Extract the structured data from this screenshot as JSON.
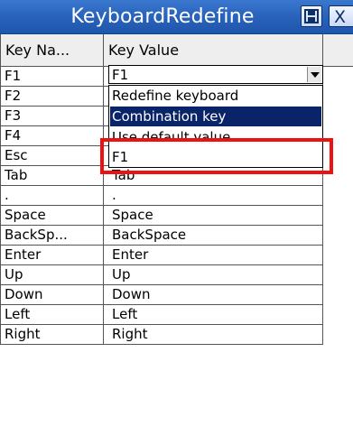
{
  "window": {
    "title": "KeyboardRedefine",
    "save_icon": "save-icon",
    "close_icon": "close-icon",
    "close_glyph": "X"
  },
  "grid": {
    "columns": [
      "Key Na...",
      "Key Value"
    ],
    "rows": [
      {
        "name": "F1",
        "value": ""
      },
      {
        "name": "F2",
        "value": ""
      },
      {
        "name": "F3",
        "value": ""
      },
      {
        "name": "F4",
        "value": ""
      },
      {
        "name": "Esc",
        "value": ""
      },
      {
        "name": "Tab",
        "value": "Tab"
      },
      {
        "name": ".",
        "value": "."
      },
      {
        "name": "Space",
        "value": "Space"
      },
      {
        "name": "BackSp...",
        "value": "BackSpace"
      },
      {
        "name": "Enter",
        "value": "Enter"
      },
      {
        "name": "Up",
        "value": "Up"
      },
      {
        "name": "Down",
        "value": "Down"
      },
      {
        "name": "Left",
        "value": "Left"
      },
      {
        "name": "Right",
        "value": "Right"
      }
    ]
  },
  "combo": {
    "selected": "F1",
    "options": [
      "Redefine keyboard",
      "Combination key",
      "Use default value",
      "F1"
    ],
    "highlighted_index": 1
  },
  "colors": {
    "title_bar": "#2a64bd",
    "selection": "#0a246a",
    "annotation": "#ee1111"
  }
}
